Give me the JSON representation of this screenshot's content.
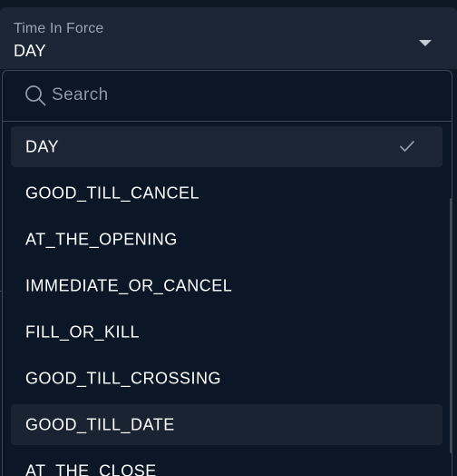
{
  "field": {
    "label": "Time In Force",
    "value": "DAY"
  },
  "search": {
    "placeholder": "Search",
    "value": ""
  },
  "options": [
    {
      "label": "DAY",
      "selected": true
    },
    {
      "label": "GOOD_TILL_CANCEL",
      "selected": false
    },
    {
      "label": "AT_THE_OPENING",
      "selected": false
    },
    {
      "label": "IMMEDIATE_OR_CANCEL",
      "selected": false
    },
    {
      "label": "FILL_OR_KILL",
      "selected": false
    },
    {
      "label": "GOOD_TILL_CROSSING",
      "selected": false
    },
    {
      "label": "GOOD_TILL_DATE",
      "selected": false
    },
    {
      "label": "AT_THE_CLOSE",
      "selected": false
    }
  ],
  "icons": {
    "search": "search-icon",
    "check": "check-icon",
    "caret": "caret-down-icon"
  },
  "colors": {
    "background": "#0e1724",
    "field_background": "#1b2535",
    "dropdown_background": "#0b1726",
    "border": "#3a4556",
    "text": "#ffffff",
    "muted_text": "#9aa3b1"
  }
}
